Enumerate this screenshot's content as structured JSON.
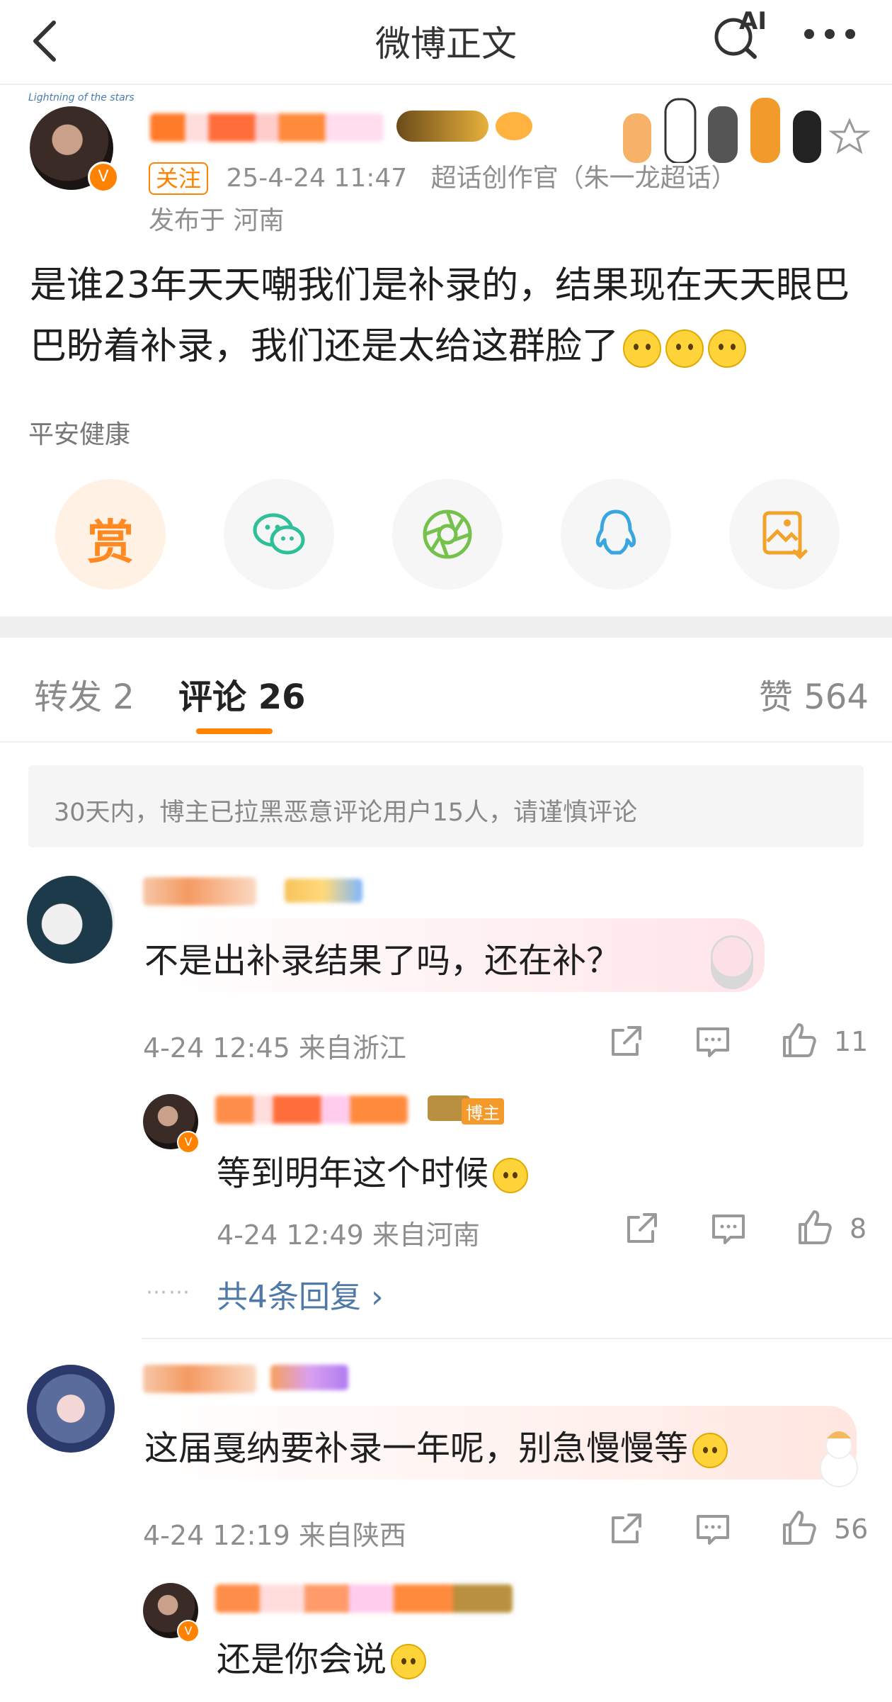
{
  "header": {
    "back_icon": "chevron-left-icon",
    "title": "微博正文",
    "ai_search_label": "AI",
    "more_icon": "more-dots-icon"
  },
  "post": {
    "avatar_caption": "Lightning of the stars",
    "follow_label": "关注",
    "time": "25-4-24 11:47",
    "source": "超话创作官（朱一龙超话）",
    "location": "发布于 河南",
    "text": "是谁23年天天嘲我们是补录的，结果现在天天眼巴巴盼着补录，我们还是太给这群脸了",
    "emoji_count": 3,
    "tag": "平安健康",
    "actions": [
      {
        "name": "reward",
        "label": "赏",
        "icon": "reward-icon"
      },
      {
        "name": "wechat",
        "icon": "wechat-icon"
      },
      {
        "name": "moments",
        "icon": "moments-icon"
      },
      {
        "name": "qq",
        "icon": "qq-icon"
      },
      {
        "name": "save-image",
        "icon": "save-image-icon"
      }
    ]
  },
  "tabs": {
    "repost": "转发 2",
    "comments": "评论 26",
    "likes": "赞 564"
  },
  "notice": "30天内，博主已拉黑恶意评论用户15人，请谨慎评论",
  "comments": [
    {
      "text": "不是出补录结果了吗，还在补？",
      "time": "4-24 12:45 来自浙江",
      "likes": "11",
      "reply": {
        "badge": "博主",
        "text": "等到明年这个时候",
        "time": "4-24 12:49 来自河南",
        "likes": "8"
      },
      "more_replies": "共4条回复 ›"
    },
    {
      "text": "这届戛纳要补录一年呢，别急慢慢等",
      "time": "4-24 12:19 来自陕西",
      "likes": "56",
      "reply": {
        "text": "还是你会说"
      }
    }
  ],
  "colors": {
    "accent": "#ff8200",
    "link": "#4f79a8",
    "wechat": "#2fc09a",
    "moments": "#74c24c",
    "qq": "#3aa6e0",
    "save": "#f2a32b"
  }
}
